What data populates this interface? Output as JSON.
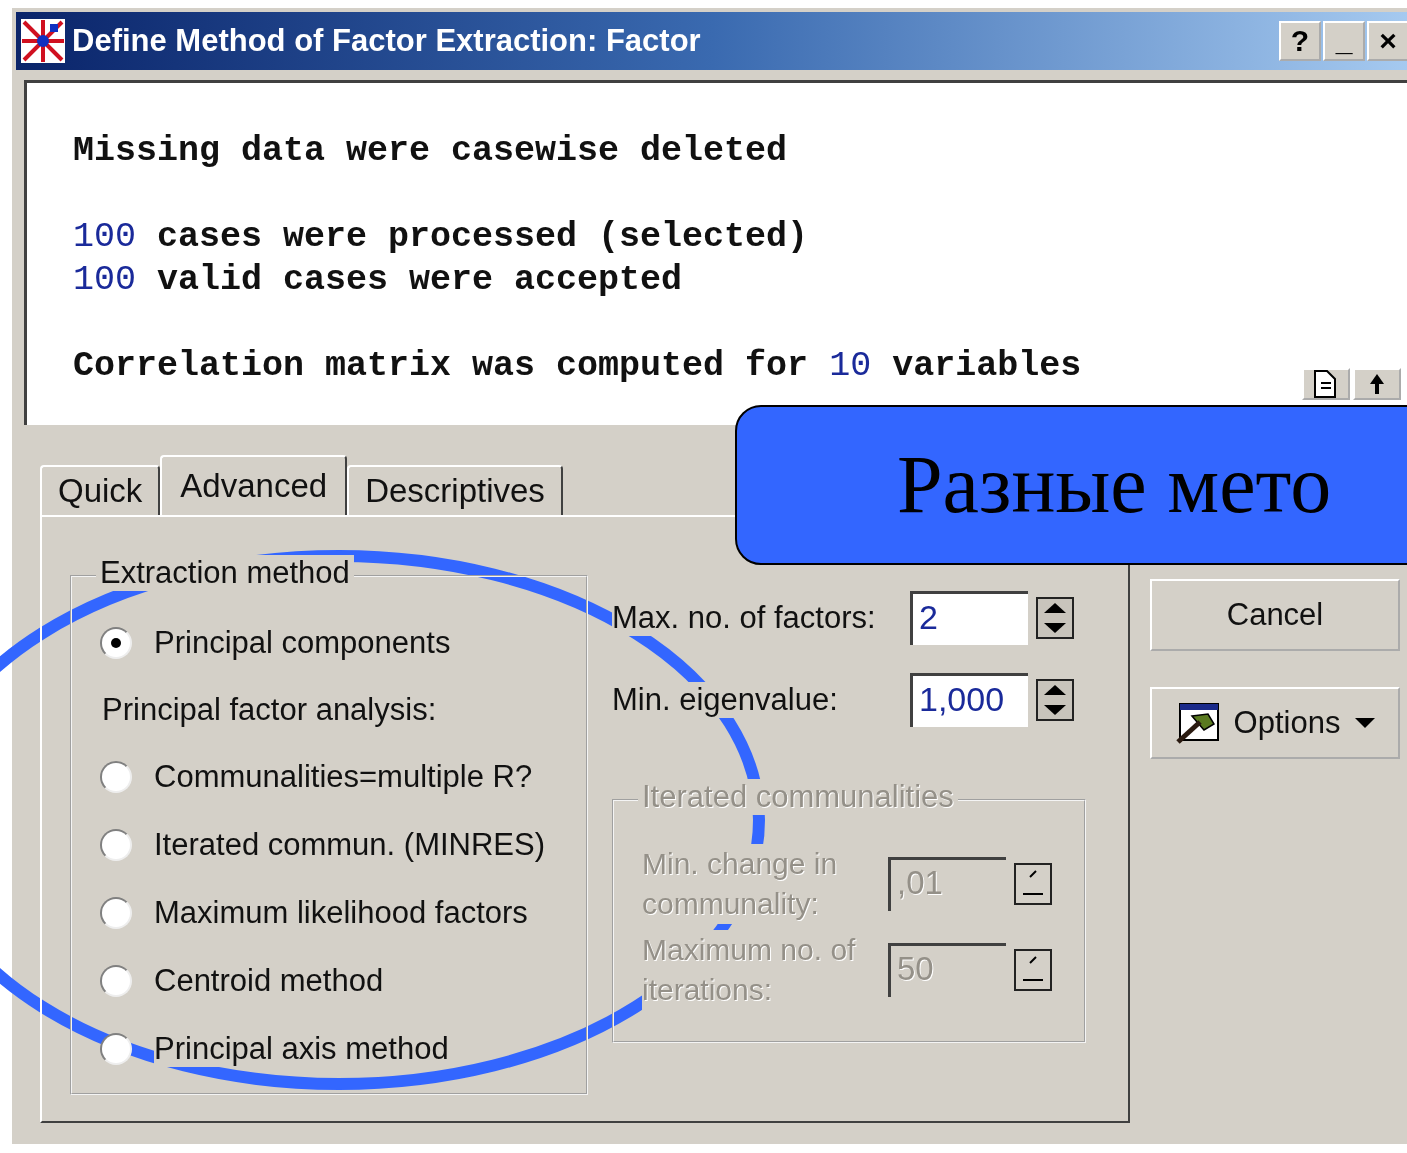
{
  "window": {
    "title": "Define Method of Factor Extraction: Factor",
    "buttons": [
      "?",
      "_",
      "×"
    ]
  },
  "output": {
    "paragraphs": [
      [
        [
          {
            "kind": "plain",
            "text": "Missing data were casewise deleted"
          }
        ]
      ],
      [
        [
          {
            "kind": "number",
            "text": "100"
          },
          {
            "kind": "plain",
            "text": " cases were processed (selected)"
          }
        ],
        [
          {
            "kind": "number",
            "text": "100"
          },
          {
            "kind": "plain",
            "text": " valid cases were accepted"
          }
        ]
      ],
      [
        [
          {
            "kind": "plain",
            "text": "Correlation matrix was computed for "
          },
          {
            "kind": "number",
            "text": "10"
          },
          {
            "kind": "plain",
            "text": " variables"
          }
        ]
      ]
    ]
  },
  "tabs": [
    {
      "label": "Quick",
      "selected": false
    },
    {
      "label": "Advanced",
      "selected": true
    },
    {
      "label": "Descriptives",
      "selected": false
    }
  ],
  "extraction_method": {
    "title": "Extraction method",
    "options": [
      {
        "kind": "radio",
        "label": "Principal components",
        "selected": true
      },
      {
        "kind": "heading",
        "label": "Principal factor analysis:"
      },
      {
        "kind": "radio",
        "label": "Communalities=multiple R?",
        "selected": false
      },
      {
        "kind": "radio",
        "label": "Iterated commun. (MINRES)",
        "selected": false
      },
      {
        "kind": "radio",
        "label": "Maximum likelihood factors",
        "selected": false
      },
      {
        "kind": "radio",
        "label": "Centroid method",
        "selected": false
      },
      {
        "kind": "radio",
        "label": "Principal axis method",
        "selected": false
      }
    ]
  },
  "parameters": [
    {
      "label": "Max. no. of factors:",
      "value": "2"
    },
    {
      "label": "Min. eigenvalue:",
      "value": "1,000"
    }
  ],
  "iterated_communalities": {
    "title": "Iterated communalities",
    "disabled": true,
    "fields": [
      {
        "label": "Min. change in communality:",
        "value": ",01"
      },
      {
        "label": "Maximum no. of iterations:",
        "value": "50"
      }
    ]
  },
  "buttons": [
    {
      "kind": "plain",
      "label": "Cancel"
    },
    {
      "kind": "menu",
      "label": "Options"
    }
  ],
  "callout": {
    "text": "Разные мето"
  }
}
